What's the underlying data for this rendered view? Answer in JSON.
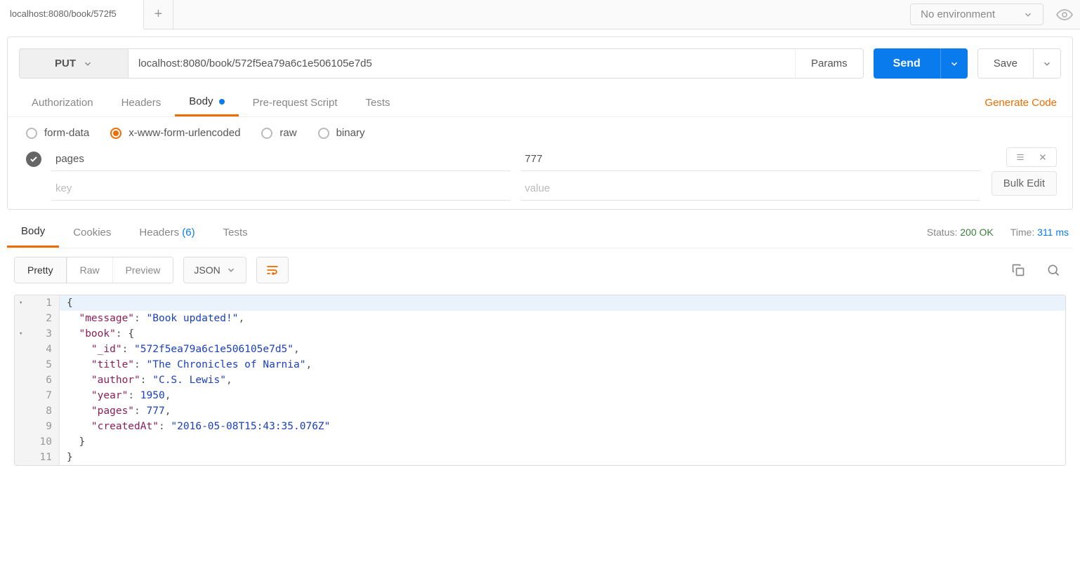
{
  "topbar": {
    "tab_title": "localhost:8080/book/572f5",
    "env_label": "No environment"
  },
  "request": {
    "method": "PUT",
    "url": "localhost:8080/book/572f5ea79a6c1e506105e7d5",
    "params_label": "Params",
    "send_label": "Send",
    "save_label": "Save"
  },
  "req_tabs": {
    "authorization": "Authorization",
    "headers": "Headers",
    "body": "Body",
    "prerequest": "Pre-request Script",
    "tests": "Tests",
    "generate_code": "Generate Code"
  },
  "body_types": {
    "form_data": "form-data",
    "urlencoded": "x-www-form-urlencoded",
    "raw": "raw",
    "binary": "binary"
  },
  "kv": {
    "rows": [
      {
        "key": "pages",
        "value": "777"
      }
    ],
    "key_placeholder": "key",
    "value_placeholder": "value",
    "bulk_edit": "Bulk Edit"
  },
  "resp_tabs": {
    "body": "Body",
    "cookies": "Cookies",
    "headers": "Headers",
    "headers_count": "(6)",
    "tests": "Tests"
  },
  "status": {
    "status_label": "Status:",
    "status_value": "200 OK",
    "time_label": "Time:",
    "time_value": "311 ms"
  },
  "view": {
    "pretty": "Pretty",
    "raw": "Raw",
    "preview": "Preview",
    "format": "JSON"
  },
  "response_json": {
    "lines": [
      {
        "n": "1",
        "fold": true,
        "indent": 0,
        "type": "brace",
        "text": "{"
      },
      {
        "n": "2",
        "indent": 1,
        "type": "kv",
        "key": "message",
        "valType": "str",
        "val": "Book updated!",
        "comma": true
      },
      {
        "n": "3",
        "fold": true,
        "indent": 1,
        "type": "keybrace",
        "key": "book",
        "text": "{"
      },
      {
        "n": "4",
        "indent": 2,
        "type": "kv",
        "key": "_id",
        "valType": "str",
        "val": "572f5ea79a6c1e506105e7d5",
        "comma": true
      },
      {
        "n": "5",
        "indent": 2,
        "type": "kv",
        "key": "title",
        "valType": "str",
        "val": "The Chronicles of Narnia",
        "comma": true
      },
      {
        "n": "6",
        "indent": 2,
        "type": "kv",
        "key": "author",
        "valType": "str",
        "val": "C.S. Lewis",
        "comma": true
      },
      {
        "n": "7",
        "indent": 2,
        "type": "kv",
        "key": "year",
        "valType": "num",
        "val": "1950",
        "comma": true
      },
      {
        "n": "8",
        "indent": 2,
        "type": "kv",
        "key": "pages",
        "valType": "num",
        "val": "777",
        "comma": true
      },
      {
        "n": "9",
        "indent": 2,
        "type": "kv",
        "key": "createdAt",
        "valType": "str",
        "val": "2016-05-08T15:43:35.076Z",
        "comma": false
      },
      {
        "n": "10",
        "indent": 1,
        "type": "brace",
        "text": "}"
      },
      {
        "n": "11",
        "indent": 0,
        "type": "brace",
        "text": "}"
      }
    ]
  }
}
